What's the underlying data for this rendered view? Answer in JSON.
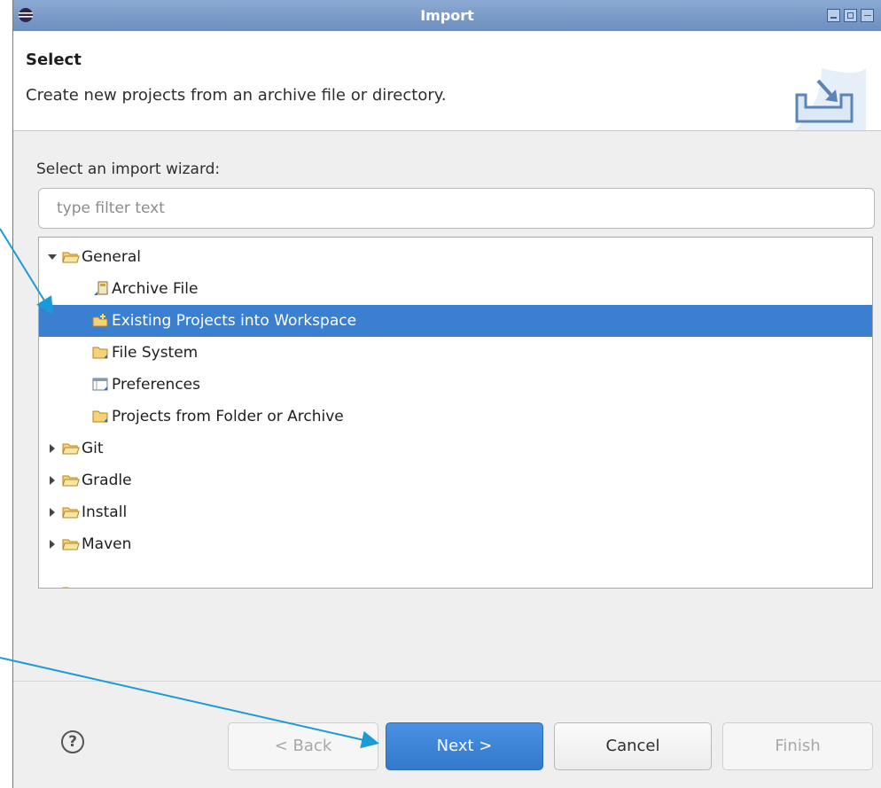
{
  "window": {
    "title": "Import",
    "logo_icon": "eclipse-logo-icon"
  },
  "header": {
    "title": "Select",
    "description": "Create new projects from an archive file or directory.",
    "icon": "import-wizard-icon"
  },
  "wizard": {
    "label": "Select an import wizard:",
    "filter_placeholder": "type filter text",
    "filter_value": ""
  },
  "tree": {
    "items": [
      {
        "label": "General",
        "expanded": true,
        "icon": "open-folder-icon"
      },
      {
        "label": "Archive File",
        "icon": "archive-file-icon"
      },
      {
        "label": "Existing Projects into Workspace",
        "icon": "existing-projects-icon",
        "selected": true
      },
      {
        "label": "File System",
        "icon": "folder-icon"
      },
      {
        "label": "Preferences",
        "icon": "preferences-icon"
      },
      {
        "label": "Projects from Folder or Archive",
        "icon": "folder-icon"
      },
      {
        "label": "Git",
        "expanded": false,
        "icon": "open-folder-icon"
      },
      {
        "label": "Gradle",
        "expanded": false,
        "icon": "open-folder-icon"
      },
      {
        "label": "Install",
        "expanded": false,
        "icon": "open-folder-icon"
      },
      {
        "label": "Maven",
        "expanded": false,
        "icon": "open-folder-icon"
      }
    ]
  },
  "buttons": {
    "back": "< Back",
    "next": "Next >",
    "cancel": "Cancel",
    "finish": "Finish",
    "help_icon": "help-icon"
  },
  "colors": {
    "selection": "#3a7fd0",
    "annotation_arrow": "#1a9ad6",
    "titlebar": "#7a9ccb"
  }
}
